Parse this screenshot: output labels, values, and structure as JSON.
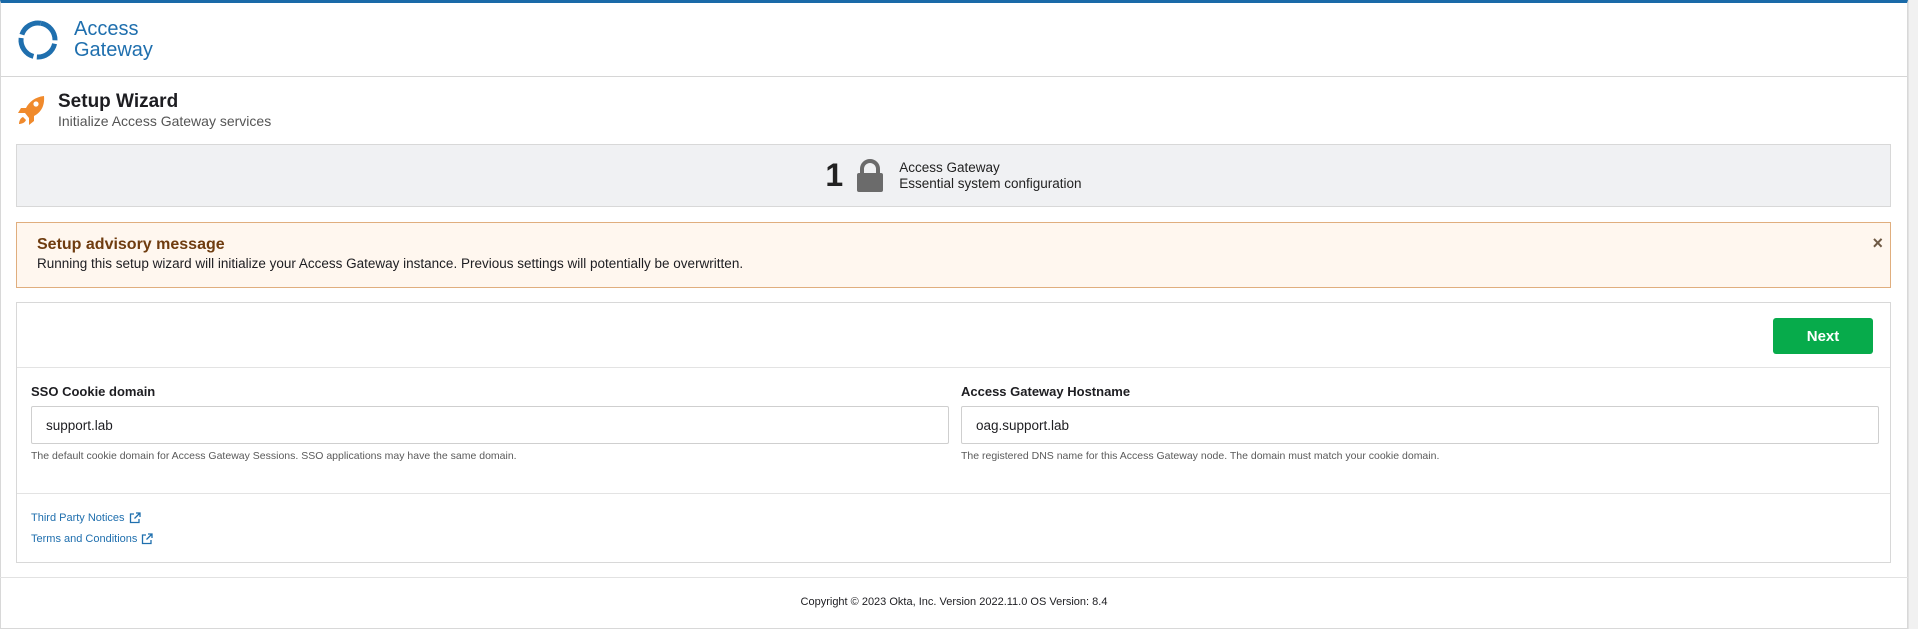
{
  "brand": {
    "line1": "Access",
    "line2": "Gateway"
  },
  "page": {
    "title": "Setup Wizard",
    "subtitle": "Initialize Access Gateway services"
  },
  "step": {
    "number": "1",
    "title": "Access Gateway",
    "description": "Essential system configuration",
    "icon": "lock-icon"
  },
  "advisory": {
    "title": "Setup advisory message",
    "body": "Running this setup wizard will initialize your Access Gateway instance. Previous settings will potentially be overwritten.",
    "close": "×"
  },
  "actions": {
    "next_label": "Next"
  },
  "form": {
    "cookie_domain": {
      "label": "SSO Cookie domain",
      "value": "support.lab",
      "help": "The default cookie domain for Access Gateway Sessions. SSO applications may have the same domain."
    },
    "hostname": {
      "label": "Access Gateway Hostname",
      "value": "oag.support.lab",
      "help": "The registered DNS name for this Access Gateway node. The domain must match your cookie domain."
    }
  },
  "links": [
    {
      "label": "Third Party Notices"
    },
    {
      "label": "Terms and Conditions"
    }
  ],
  "footer": {
    "text": "Copyright © 2023 Okta, Inc. Version 2022.11.0 OS Version: 8.4"
  },
  "colors": {
    "brand": "#1f6fae",
    "accent_top": "#1a6aa8",
    "next": "#07ab4b",
    "rocket": "#f08a2c",
    "advisory_bg": "#fff7ef"
  }
}
